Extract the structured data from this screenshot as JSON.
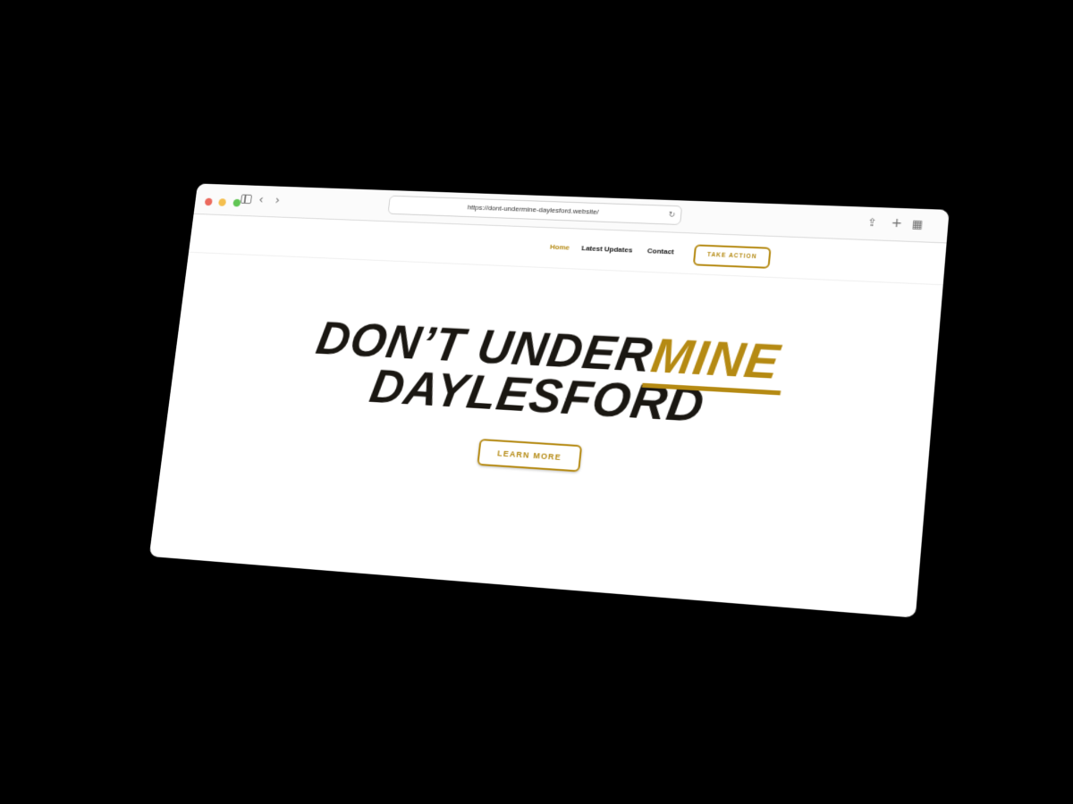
{
  "browser": {
    "url": "https://dont-undermine-daylesford.website/",
    "icons": {
      "sidebar": "sidebar-icon",
      "back": "chevron-left-icon",
      "forward": "chevron-right-icon",
      "reload": "reload-icon",
      "share": "share-icon",
      "new_tab": "plus-icon",
      "tabs": "tab-grid-icon"
    }
  },
  "nav": {
    "items": [
      {
        "label": "Home",
        "active": true
      },
      {
        "label": "Latest Updates",
        "active": false
      },
      {
        "label": "Contact",
        "active": false
      }
    ],
    "cta_label": "TAKE ACTION"
  },
  "hero": {
    "line1_prefix": "DON’T UNDER",
    "line1_accent": "MINE",
    "line2": "DAYLESFORD",
    "button_label": "LEARN MORE"
  },
  "colors": {
    "accent": "#b58a13",
    "text_dark": "#1a1712",
    "background": "#ffffff"
  }
}
